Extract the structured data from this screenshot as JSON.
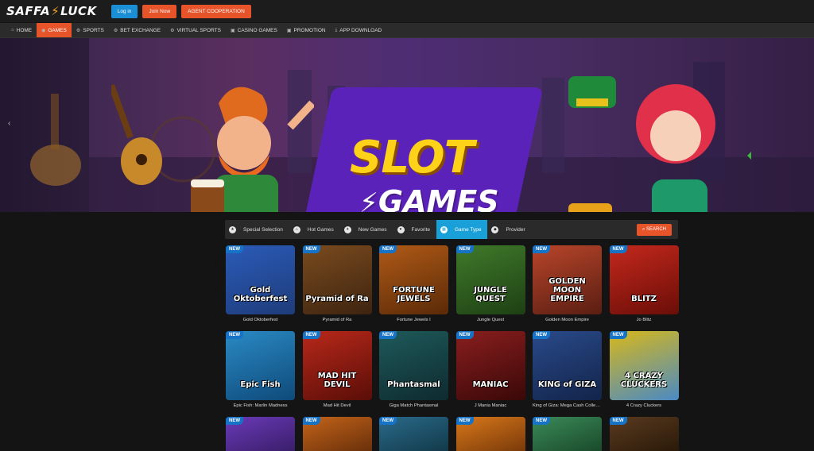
{
  "header": {
    "logo_text_a": "SAFFA",
    "logo_text_b": "LUCK",
    "login_label": "Log in",
    "join_label": "Join Now",
    "agent_label": "AGENT COOPERATION"
  },
  "nav": {
    "items": [
      {
        "label": "HOME",
        "icon": "home-icon",
        "glyph": "⌂"
      },
      {
        "label": "GAMES",
        "icon": "games-icon",
        "glyph": "◉",
        "active": true
      },
      {
        "label": "SPORTS",
        "icon": "sports-icon",
        "glyph": "⚙"
      },
      {
        "label": "BET EXCHANGE",
        "icon": "exchange-icon",
        "glyph": "⚙"
      },
      {
        "label": "VIRTUAL SPORTS",
        "icon": "virtual-icon",
        "glyph": "⚙"
      },
      {
        "label": "CASINO GAMES",
        "icon": "casino-icon",
        "glyph": "▣"
      },
      {
        "label": "PROMOTION",
        "icon": "gift-icon",
        "glyph": "▣"
      },
      {
        "label": "APP DOWNLOAD",
        "icon": "download-icon",
        "glyph": "⤓"
      }
    ]
  },
  "banner": {
    "title": "SLOT",
    "subtitle": "GAMES"
  },
  "filter": {
    "tabs": [
      {
        "label": "Special Selection",
        "icon": "star-icon",
        "glyph": "★"
      },
      {
        "label": "Hot Games",
        "icon": "flame-icon",
        "glyph": "♨"
      },
      {
        "label": "New Games",
        "icon": "new-icon",
        "glyph": "✦"
      },
      {
        "label": "Favorite",
        "icon": "heart-icon",
        "glyph": "♥"
      },
      {
        "label": "Game Type",
        "icon": "grid-icon",
        "glyph": "▦",
        "active": true
      },
      {
        "label": "Provider",
        "icon": "provider-icon",
        "glyph": "◆"
      }
    ],
    "search_label": "SEARCH"
  },
  "games": [
    {
      "name": "Gold Oktoberfest",
      "art": "Gold Oktoberfest",
      "badge": "NEW",
      "bg": "#2a5bb8",
      "bg2": "#1e3c7a"
    },
    {
      "name": "Pyramid of Ra",
      "art": "Pyramid of Ra",
      "badge": "NEW",
      "bg": "#7a4b1e",
      "bg2": "#3e2410"
    },
    {
      "name": "Fortune Jewels I",
      "art": "FORTUNE JEWELS",
      "badge": "NEW",
      "bg": "#b05a16",
      "bg2": "#5a2a08"
    },
    {
      "name": "Jungle Quest",
      "art": "JUNGLE QUEST",
      "badge": "NEW",
      "bg": "#3f7a2a",
      "bg2": "#1e4014"
    },
    {
      "name": "Golden Moon Empire",
      "art": "GOLDEN MOON EMPIRE",
      "badge": "NEW",
      "bg": "#b8452a",
      "bg2": "#5a1e12"
    },
    {
      "name": "Jo Blitz",
      "art": "BLITZ",
      "badge": "NEW",
      "bg": "#c4281c",
      "bg2": "#6a0e08"
    },
    {
      "name": "Epic Fish: Marlin Madness",
      "art": "Epic Fish",
      "badge": "NEW",
      "bg": "#2a8ac4",
      "bg2": "#0e4a7a"
    },
    {
      "name": "Mad Hit Devil",
      "art": "MAD HIT DEVIL",
      "badge": "NEW",
      "bg": "#b8281a",
      "bg2": "#5a0e08"
    },
    {
      "name": "Giga Match Phantasmal",
      "art": "Phantasmal",
      "badge": "NEW",
      "bg": "#1e5a5a",
      "bg2": "#0e2a30"
    },
    {
      "name": "J Mania Maniac",
      "art": "MANIAC",
      "badge": "NEW",
      "bg": "#8a1e1e",
      "bg2": "#3a0808"
    },
    {
      "name": "King of Giza: Mega Cash Collect & Link",
      "art": "KING of GIZA",
      "badge": "NEW",
      "bg": "#2a4a8a",
      "bg2": "#12244a"
    },
    {
      "name": "4 Crazy Cluckers",
      "art": "4 CRAZY CLUCKERS",
      "badge": "NEW",
      "bg": "#d8b81a",
      "bg2": "#4a8ac4"
    },
    {
      "name": "",
      "art": "",
      "badge": "NEW",
      "bg": "#6a3ab8",
      "bg2": "#3a1e6a"
    },
    {
      "name": "",
      "art": "",
      "badge": "NEW",
      "bg": "#c4641a",
      "bg2": "#6a300a"
    },
    {
      "name": "",
      "art": "",
      "badge": "NEW",
      "bg": "#2a6a8a",
      "bg2": "#123a4a"
    },
    {
      "name": "",
      "art": "",
      "badge": "NEW",
      "bg": "#d8781a",
      "bg2": "#7a3a0a"
    },
    {
      "name": "",
      "art": "",
      "badge": "NEW",
      "bg": "#3a8a5a",
      "bg2": "#1a4a2a"
    },
    {
      "name": "",
      "art": "",
      "badge": "NEW",
      "bg": "#5a3a1e",
      "bg2": "#2a1a0a"
    }
  ]
}
